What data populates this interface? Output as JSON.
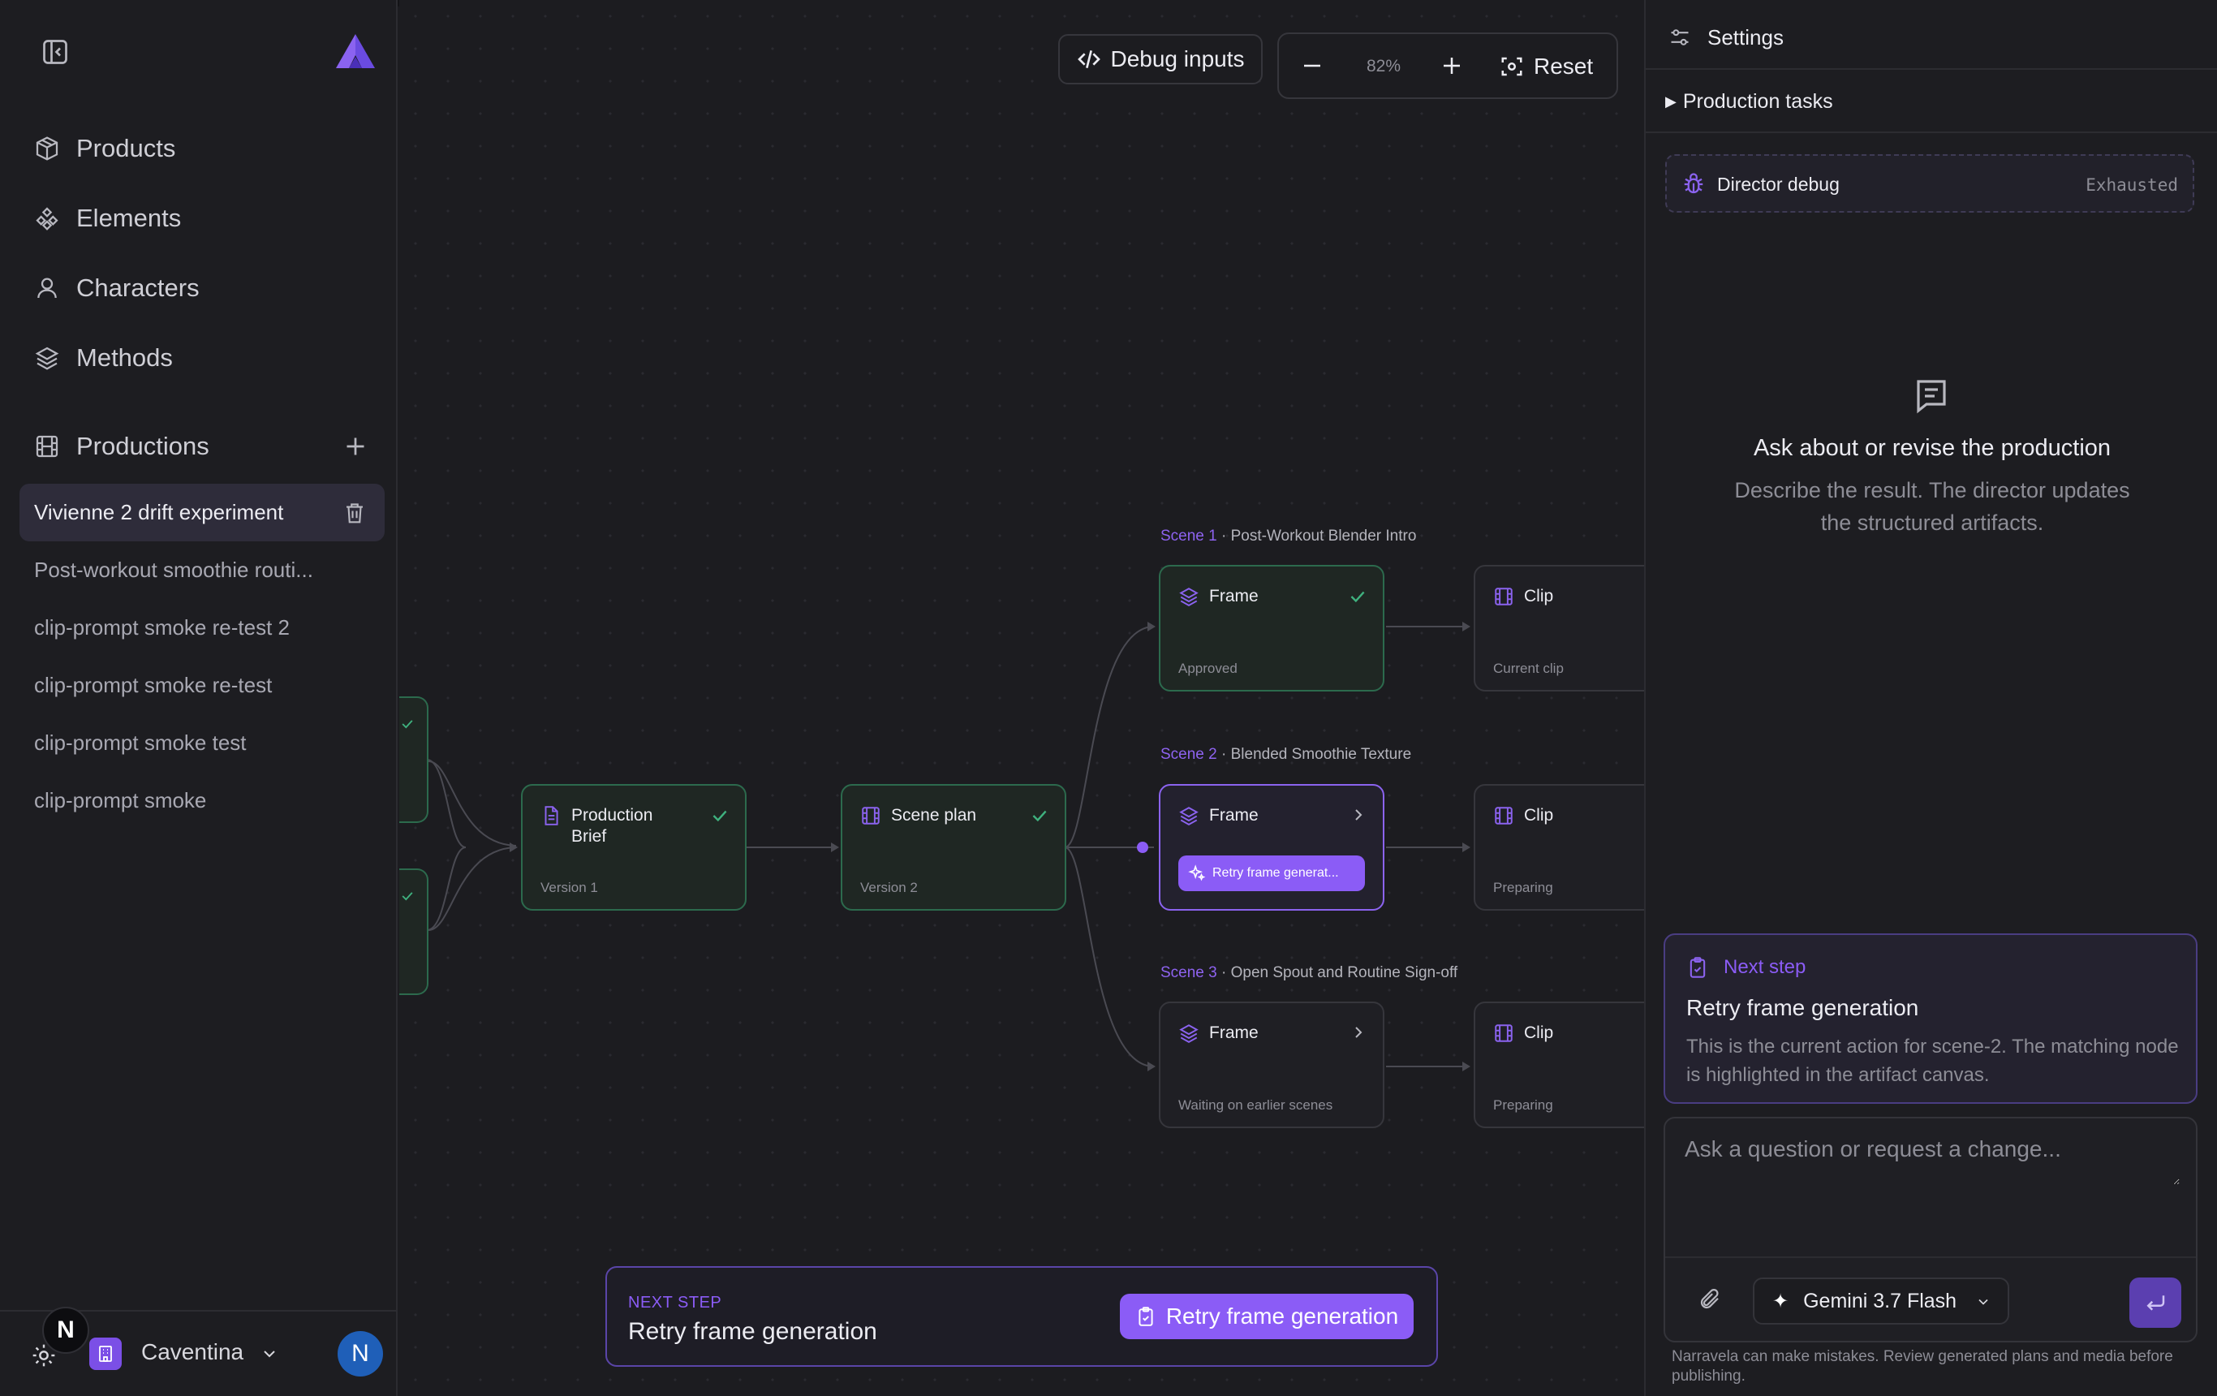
{
  "sidebar": {
    "nav": [
      {
        "label": "Products",
        "icon": "package-icon"
      },
      {
        "label": "Elements",
        "icon": "shapes-icon"
      },
      {
        "label": "Characters",
        "icon": "user-icon"
      },
      {
        "label": "Methods",
        "icon": "layers-icon"
      }
    ],
    "productions_label": "Productions",
    "productions": [
      {
        "label": "Vivienne 2 drift experiment",
        "active": true
      },
      {
        "label": "Post-workout smoothie routi..."
      },
      {
        "label": "clip-prompt smoke re-test 2"
      },
      {
        "label": "clip-prompt smoke re-test"
      },
      {
        "label": "clip-prompt smoke test"
      },
      {
        "label": "clip-prompt smoke"
      }
    ],
    "badge": "N",
    "org_name": "Caventina",
    "avatar_initial": "N"
  },
  "canvas": {
    "debug_inputs_label": "Debug inputs",
    "zoom_level": "82%",
    "reset_label": "Reset",
    "nodes": {
      "brief": {
        "title": "Production Brief",
        "status": "Version 1"
      },
      "scene_plan": {
        "title": "Scene plan",
        "status": "Version 2"
      }
    },
    "scenes": [
      {
        "number": "Scene 1",
        "title": " · Post-Workout Blender Intro",
        "frame": {
          "title": "Frame",
          "status": "Approved"
        },
        "clip": {
          "title": "Clip",
          "status": "Current clip"
        }
      },
      {
        "number": "Scene 2",
        "title": " · Blended Smoothie Texture",
        "frame": {
          "title": "Frame",
          "action": "Retry frame generat..."
        },
        "clip": {
          "title": "Clip",
          "status": "Preparing"
        }
      },
      {
        "number": "Scene 3",
        "title": " · Open Spout and Routine Sign-off",
        "frame": {
          "title": "Frame",
          "status": "Waiting on earlier scenes"
        },
        "clip": {
          "title": "Clip",
          "status": "Preparing"
        }
      }
    ],
    "next_step": {
      "label": "NEXT STEP",
      "title": "Retry frame generation",
      "button": "Retry frame generation"
    }
  },
  "panel": {
    "settings_label": "Settings",
    "production_tasks_label": "Production tasks",
    "director_debug": {
      "label": "Director debug",
      "status": "Exhausted"
    },
    "empty": {
      "title": "Ask about or revise the production",
      "subtitle": "Describe the result. The director updates the structured artifacts."
    },
    "next_step": {
      "label": "Next step",
      "title": "Retry frame generation",
      "description": "This is the current action for scene-2. The matching node is highlighted in the artifact canvas."
    },
    "chat_placeholder": "Ask a question or request a change...",
    "model": "Gemini 3.7 Flash",
    "disclaimer": "Narravela can make mistakes. Review generated plans and media before publishing."
  },
  "colors": {
    "accent": "#8b5cf6",
    "success": "#3fb27f",
    "background": "#1c1c20"
  }
}
